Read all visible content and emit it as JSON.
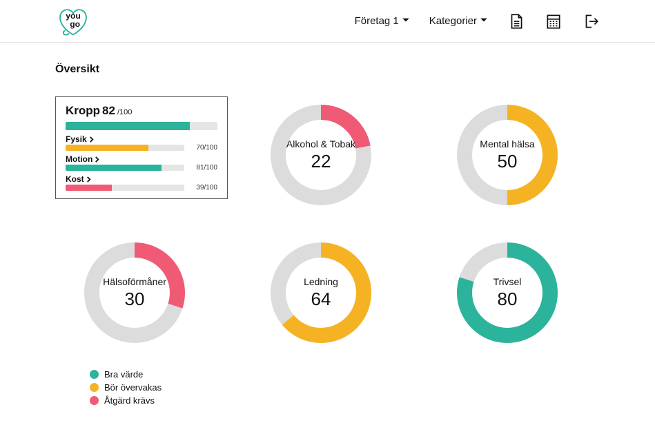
{
  "colors": {
    "good": "#2bb39b",
    "watch": "#f5b324",
    "action": "#ef5a74",
    "track": "#dcdcdc"
  },
  "header": {
    "company_label": "Företag 1",
    "categories_label": "Kategorier"
  },
  "page_title": "Översikt",
  "detail": {
    "title_name": "Kropp",
    "score": 82,
    "max_suffix": "/100",
    "bar_color_key": "good",
    "rows": [
      {
        "label": "Fysik",
        "score": 70,
        "max": 100,
        "color_key": "watch"
      },
      {
        "label": "Motion",
        "score": 81,
        "max": 100,
        "color_key": "good"
      },
      {
        "label": "Kost",
        "score": 39,
        "max": 100,
        "color_key": "action"
      }
    ]
  },
  "donuts": [
    {
      "label": "Alkohol & Tobak",
      "value": 22,
      "color_key": "action"
    },
    {
      "label": "Mental hälsa",
      "value": 50,
      "color_key": "watch"
    },
    {
      "label": "Hälsoförmåner",
      "value": 30,
      "color_key": "action"
    },
    {
      "label": "Ledning",
      "value": 64,
      "color_key": "watch"
    },
    {
      "label": "Trivsel",
      "value": 80,
      "color_key": "good"
    }
  ],
  "legend": [
    {
      "label": "Bra värde",
      "color_key": "good"
    },
    {
      "label": "Bör övervakas",
      "color_key": "watch"
    },
    {
      "label": "Åtgärd krävs",
      "color_key": "action"
    }
  ],
  "chart_data": {
    "type": "bar",
    "title": "Översikt",
    "ylim": [
      0,
      100
    ],
    "series": [
      {
        "name": "Kropp",
        "value": 82,
        "status": "good",
        "sub": [
          {
            "name": "Fysik",
            "value": 70,
            "status": "watch"
          },
          {
            "name": "Motion",
            "value": 81,
            "status": "good"
          },
          {
            "name": "Kost",
            "value": 39,
            "status": "action"
          }
        ]
      },
      {
        "name": "Alkohol & Tobak",
        "value": 22,
        "status": "action"
      },
      {
        "name": "Mental hälsa",
        "value": 50,
        "status": "watch"
      },
      {
        "name": "Hälsoförmåner",
        "value": 30,
        "status": "action"
      },
      {
        "name": "Ledning",
        "value": 64,
        "status": "watch"
      },
      {
        "name": "Trivsel",
        "value": 80,
        "status": "good"
      }
    ],
    "legend": [
      {
        "name": "Bra värde",
        "status": "good"
      },
      {
        "name": "Bör övervakas",
        "status": "watch"
      },
      {
        "name": "Åtgärd krävs",
        "status": "action"
      }
    ]
  }
}
